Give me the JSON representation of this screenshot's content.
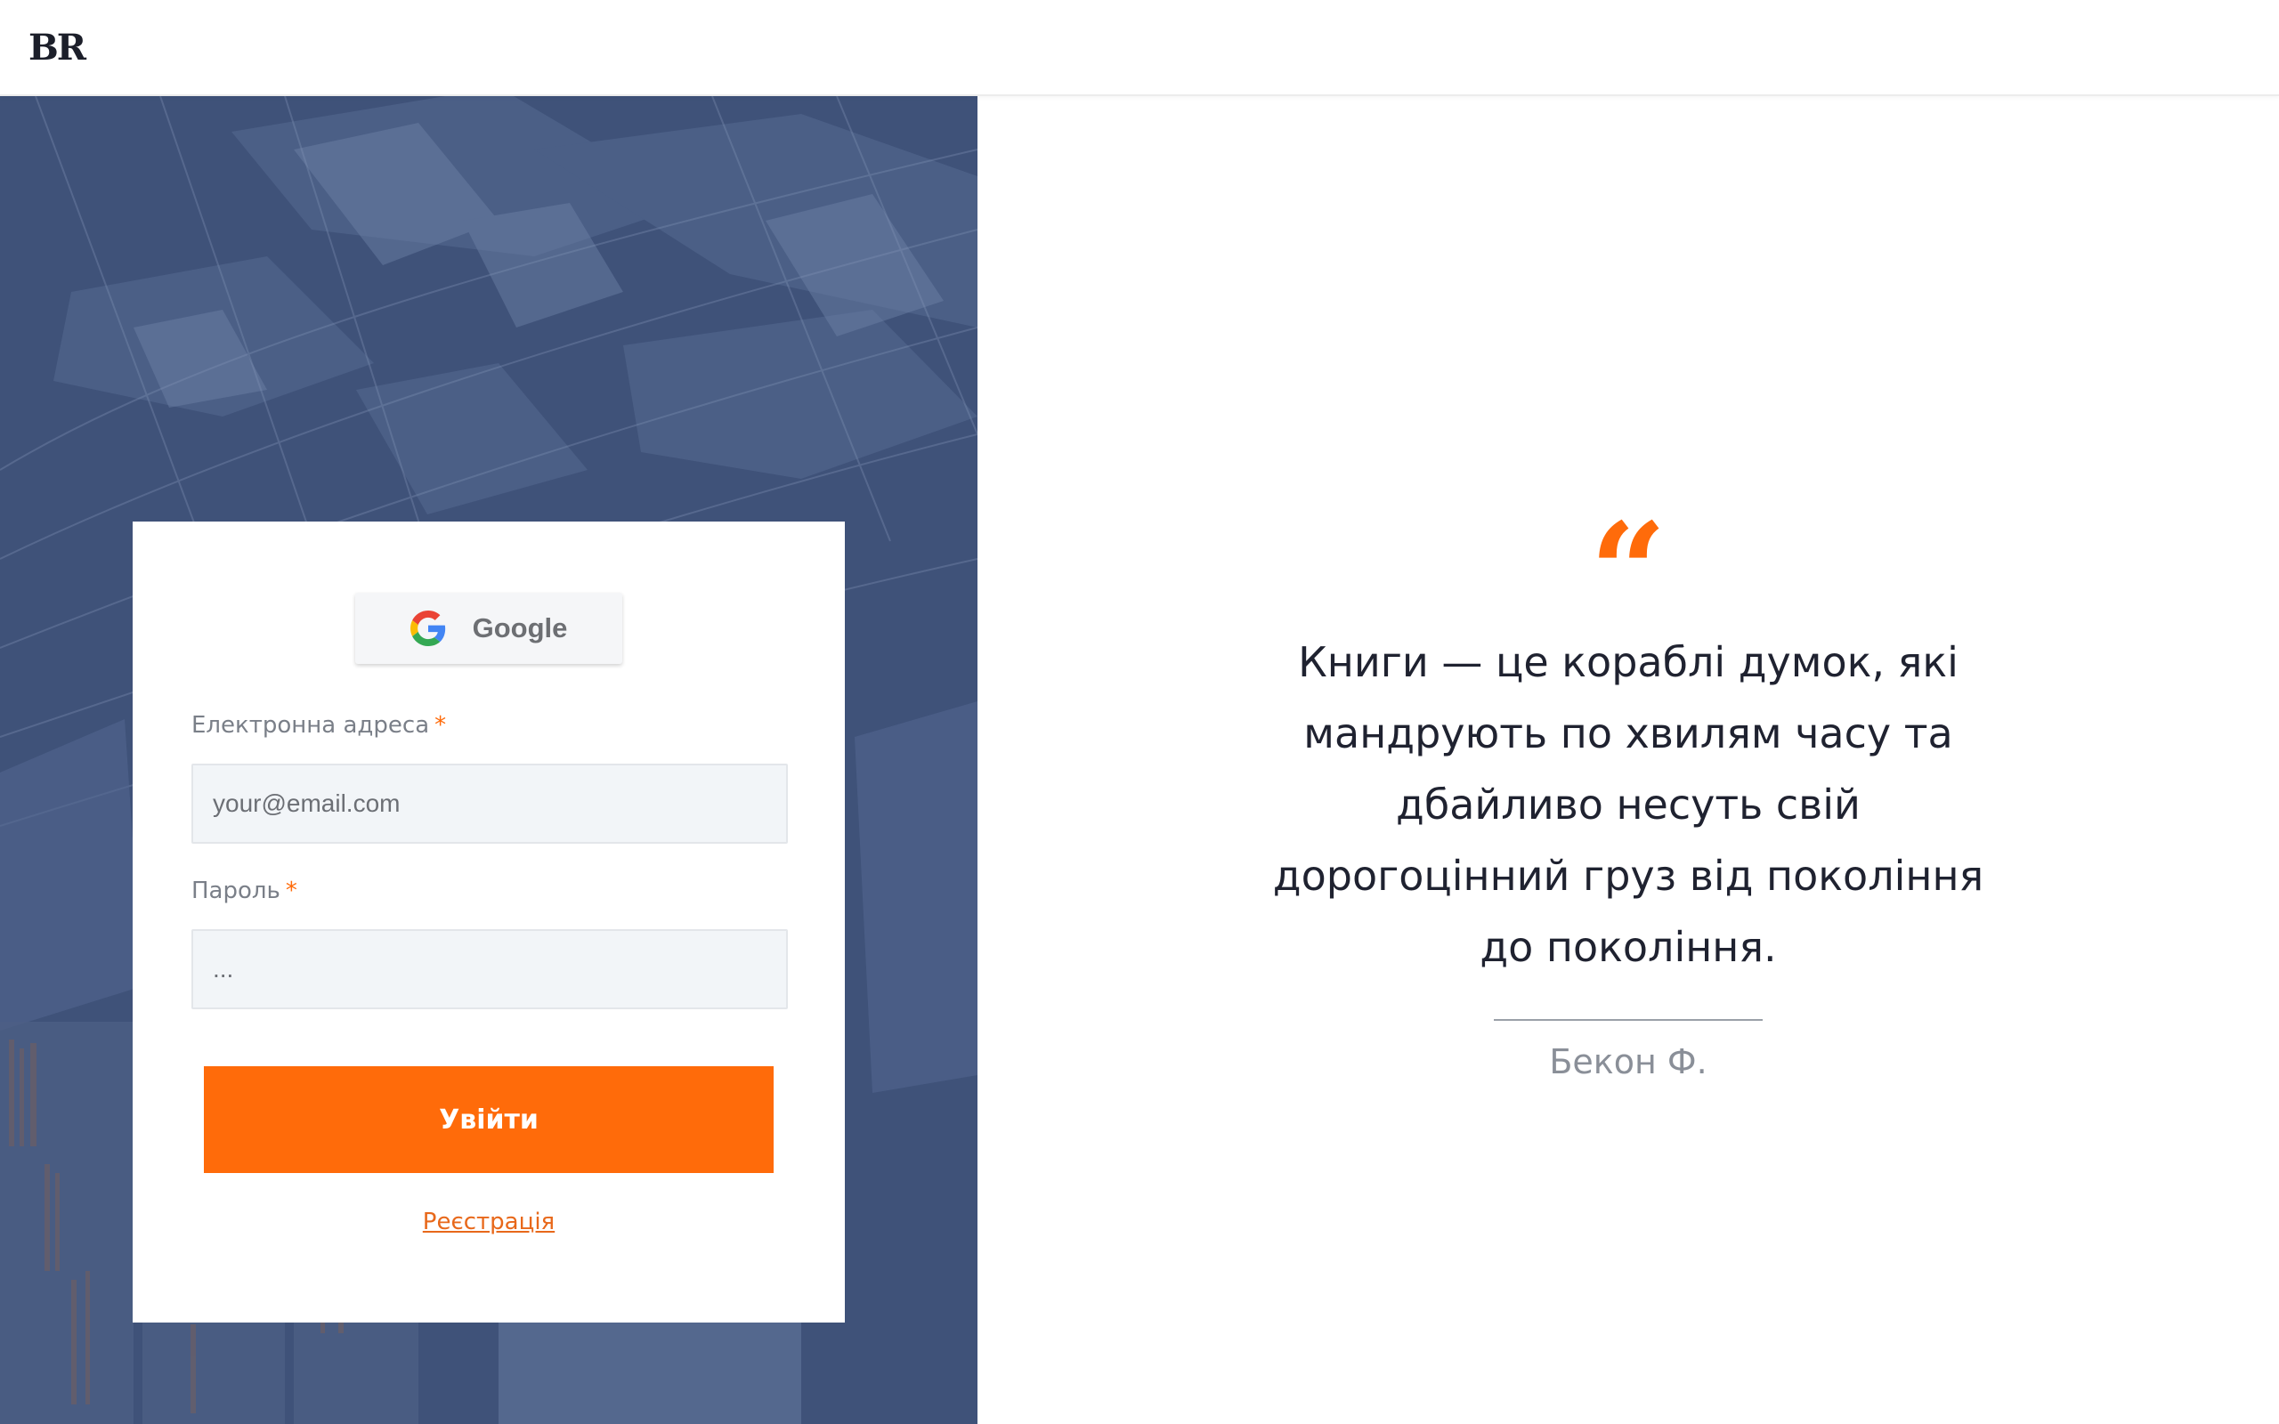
{
  "header": {
    "logo": "BR"
  },
  "login": {
    "google_label": "Google",
    "email_label": "Електронна адреса",
    "email_placeholder": "your@email.com",
    "email_value": "",
    "password_label": "Пароль",
    "password_placeholder": "...",
    "password_value": "",
    "required_mark": "*",
    "submit_label": "Увійти",
    "register_label": "Реєстрація"
  },
  "quote": {
    "mark": "“",
    "text": "Книги — це кораблі думок, які мандрують по хвилям часу та дбайливо несуть свій дорогоцінний груз від покоління до покоління.",
    "author": "Бекон Ф."
  },
  "colors": {
    "accent": "#ff6b0a",
    "panel_overlay": "#3d5075",
    "text_dark": "#1f2230",
    "text_muted": "#8a8f98"
  }
}
